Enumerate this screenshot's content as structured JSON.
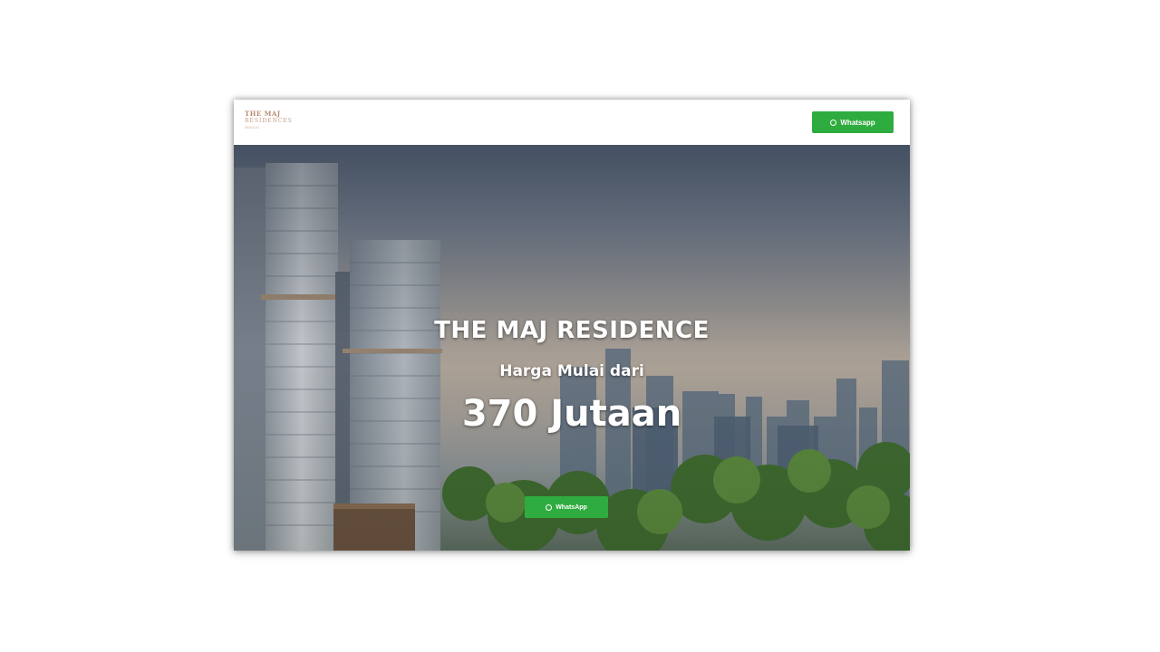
{
  "header": {
    "logo": {
      "line1": "THE MAJ",
      "line2": "RESIDENCES",
      "line3": "BEKASI"
    },
    "whatsapp_label": "Whatsapp"
  },
  "hero": {
    "title": "THE MAJ RESIDENCE",
    "subtitle": "Harga Mulai dari",
    "price": "370 Jutaan",
    "whatsapp_label": "WhatsApp"
  },
  "colors": {
    "brand_accent": "#b88a72",
    "whatsapp_green": "#2fac3f"
  },
  "icons": {
    "whatsapp": "whatsapp-icon"
  }
}
